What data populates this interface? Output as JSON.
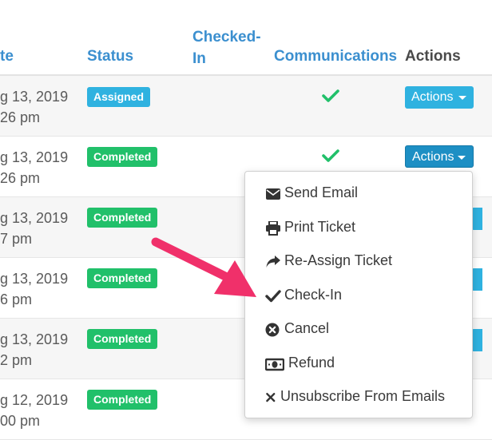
{
  "table": {
    "headers": {
      "date_partial": "te",
      "status": "Status",
      "checked_in_line1": "Checked-",
      "checked_in_line2": "In",
      "communications": "Communications",
      "actions": "Actions"
    },
    "rows": [
      {
        "date": "g 13, 2019",
        "time": "26 pm",
        "status": "Assigned",
        "checked_in": true,
        "action_label": "Actions"
      },
      {
        "date": "g 13, 2019",
        "time": "26 pm",
        "status": "Completed",
        "checked_in": true,
        "action_label": "Actions"
      },
      {
        "date": "g 13, 2019",
        "time": "7 pm",
        "status": "Completed",
        "checked_in": false
      },
      {
        "date": "g 13, 2019",
        "time": "6 pm",
        "status": "Completed",
        "checked_in": false
      },
      {
        "date": "g 13, 2019",
        "time": "2 pm",
        "status": "Completed",
        "checked_in": false
      },
      {
        "date": "g 12, 2019",
        "time": "00 pm",
        "status": "Completed",
        "checked_in": false
      }
    ]
  },
  "dropdown": {
    "items": [
      {
        "label": "Send Email",
        "icon": "envelope-icon"
      },
      {
        "label": "Print Ticket",
        "icon": "printer-icon"
      },
      {
        "label": "Re-Assign Ticket",
        "icon": "share-arrow-icon"
      },
      {
        "label": "Check-In",
        "icon": "check-icon"
      },
      {
        "label": "Cancel",
        "icon": "times-circle-icon"
      },
      {
        "label": "Refund",
        "icon": "money-bill-icon"
      },
      {
        "label": "Unsubscribe From Emails",
        "icon": "times-icon"
      }
    ]
  },
  "colors": {
    "link_header": "#3b8fcf",
    "badge_assigned": "#2fb2e0",
    "badge_completed": "#21c06a",
    "action_button": "#2fb2e0",
    "check_mark": "#21c06a",
    "annotation_arrow": "#f0306a"
  }
}
